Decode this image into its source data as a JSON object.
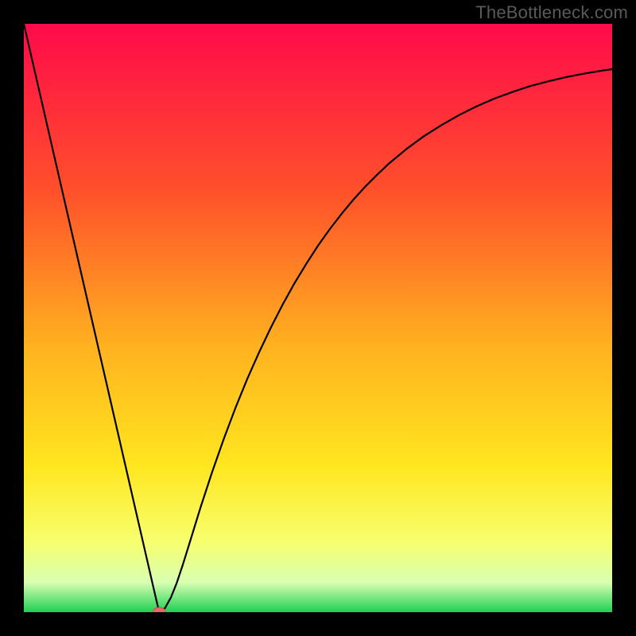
{
  "watermark": "TheBottleneck.com",
  "colors": {
    "bg_black": "#000000",
    "grad_top": "#ff0a4a",
    "grad_mid1": "#ff4f2b",
    "grad_mid2": "#ffb21f",
    "grad_mid3": "#ffe61f",
    "grad_low1": "#f7ff6e",
    "grad_low2": "#d8ffb2",
    "grad_bottom": "#1fd053",
    "curve": "#000000",
    "marker_fill": "#e46a6a",
    "marker_stroke": "#c94f55"
  },
  "chart_data": {
    "type": "line",
    "title": "",
    "xlabel": "",
    "ylabel": "",
    "xlim": [
      0,
      100
    ],
    "ylim": [
      0,
      100
    ],
    "x": [
      0,
      2,
      4,
      6,
      8,
      10,
      12,
      14,
      16,
      18,
      20,
      22,
      23,
      24,
      25,
      26,
      27,
      28,
      30,
      32,
      34,
      36,
      38,
      40,
      42,
      44,
      46,
      48,
      50,
      52,
      54,
      56,
      58,
      60,
      62,
      65,
      68,
      71,
      74,
      77,
      80,
      83,
      86,
      89,
      92,
      95,
      98,
      100
    ],
    "y": [
      100,
      91.3,
      82.6,
      73.9,
      65.2,
      56.5,
      47.8,
      39.1,
      30.4,
      21.7,
      13.0,
      4.3,
      0.0,
      0.7,
      2.5,
      5.0,
      8.0,
      11.2,
      17.7,
      23.8,
      29.5,
      34.8,
      39.7,
      44.2,
      48.4,
      52.3,
      55.9,
      59.2,
      62.3,
      65.1,
      67.7,
      70.1,
      72.3,
      74.3,
      76.2,
      78.7,
      80.9,
      82.8,
      84.5,
      86.0,
      87.3,
      88.4,
      89.4,
      90.2,
      90.9,
      91.5,
      92.0,
      92.3
    ],
    "marker": {
      "x": 23,
      "y": 0
    }
  }
}
